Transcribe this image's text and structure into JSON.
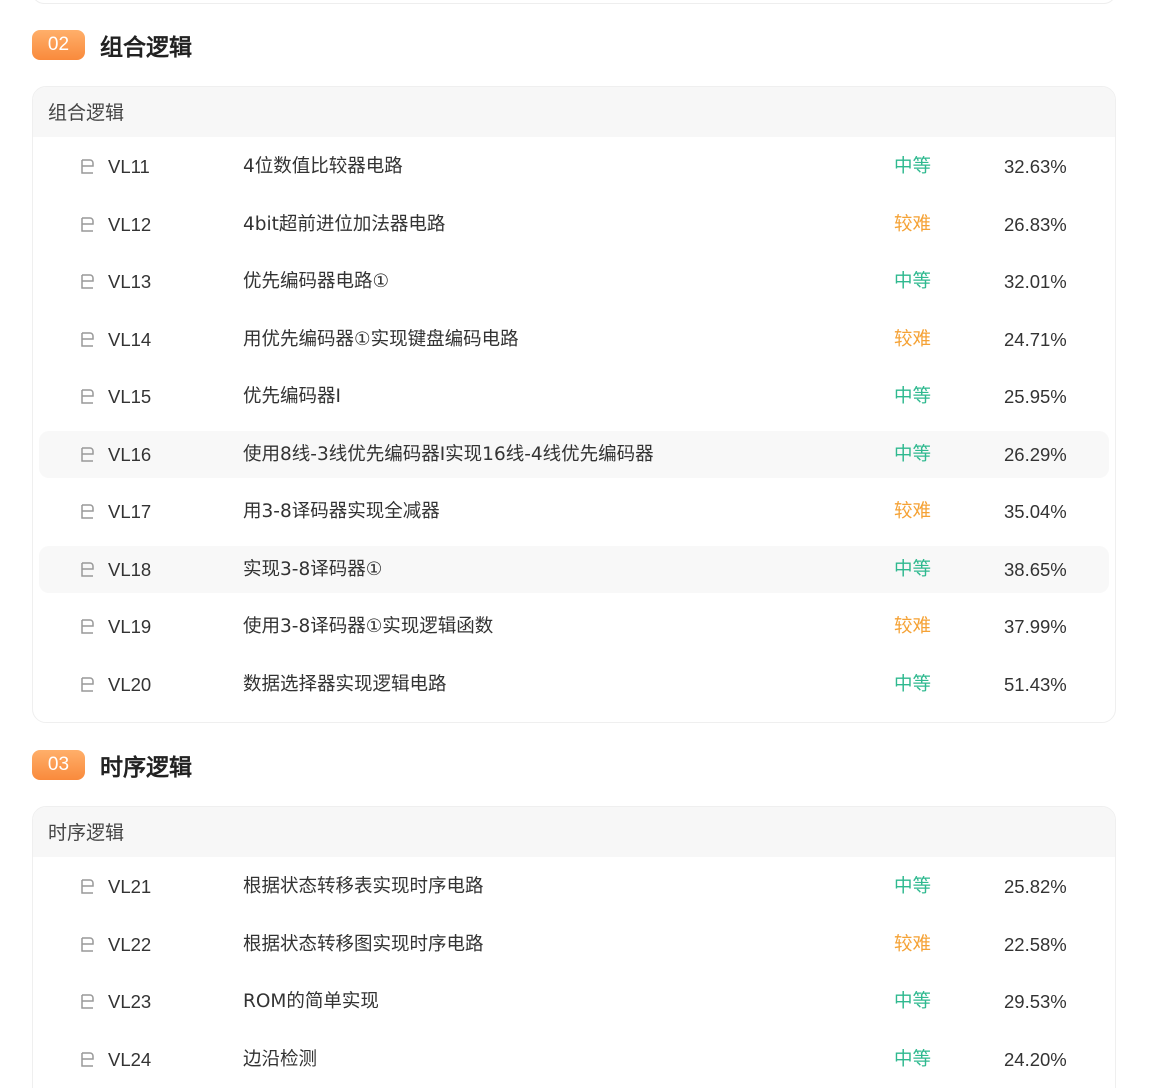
{
  "sections": [
    {
      "number": "02",
      "title": "组合逻辑",
      "card_title": "组合逻辑",
      "rows": [
        {
          "code": "VL11",
          "name": "4位数值比较器电路",
          "difficulty": "中等",
          "rate": "32.63%"
        },
        {
          "code": "VL12",
          "name": "4bit超前进位加法器电路",
          "difficulty": "较难",
          "rate": "26.83%"
        },
        {
          "code": "VL13",
          "name": "优先编码器电路①",
          "difficulty": "中等",
          "rate": "32.01%"
        },
        {
          "code": "VL14",
          "name": "用优先编码器①实现键盘编码电路",
          "difficulty": "较难",
          "rate": "24.71%"
        },
        {
          "code": "VL15",
          "name": "优先编码器Ⅰ",
          "difficulty": "中等",
          "rate": "25.95%"
        },
        {
          "code": "VL16",
          "name": "使用8线-3线优先编码器Ⅰ实现16线-4线优先编码器",
          "difficulty": "中等",
          "rate": "26.29%"
        },
        {
          "code": "VL17",
          "name": "用3-8译码器实现全减器",
          "difficulty": "较难",
          "rate": "35.04%"
        },
        {
          "code": "VL18",
          "name": "实现3-8译码器①",
          "difficulty": "中等",
          "rate": "38.65%"
        },
        {
          "code": "VL19",
          "name": "使用3-8译码器①实现逻辑函数",
          "difficulty": "较难",
          "rate": "37.99%"
        },
        {
          "code": "VL20",
          "name": "数据选择器实现逻辑电路",
          "difficulty": "中等",
          "rate": "51.43%"
        }
      ]
    },
    {
      "number": "03",
      "title": "时序逻辑",
      "card_title": "时序逻辑",
      "rows": [
        {
          "code": "VL21",
          "name": "根据状态转移表实现时序电路",
          "difficulty": "中等",
          "rate": "25.82%"
        },
        {
          "code": "VL22",
          "name": "根据状态转移图实现时序电路",
          "difficulty": "较难",
          "rate": "22.58%"
        },
        {
          "code": "VL23",
          "name": "ROM的简单实现",
          "difficulty": "中等",
          "rate": "29.53%"
        },
        {
          "code": "VL24",
          "name": "边沿检测",
          "difficulty": "中等",
          "rate": "24.20%"
        }
      ]
    }
  ],
  "colors": {
    "medium": "#2fb98f",
    "hard": "#f5a235",
    "badge_from": "#ffaf6a",
    "badge_to": "#f98a3c"
  },
  "icons": {
    "row_icon": "document-icon"
  }
}
